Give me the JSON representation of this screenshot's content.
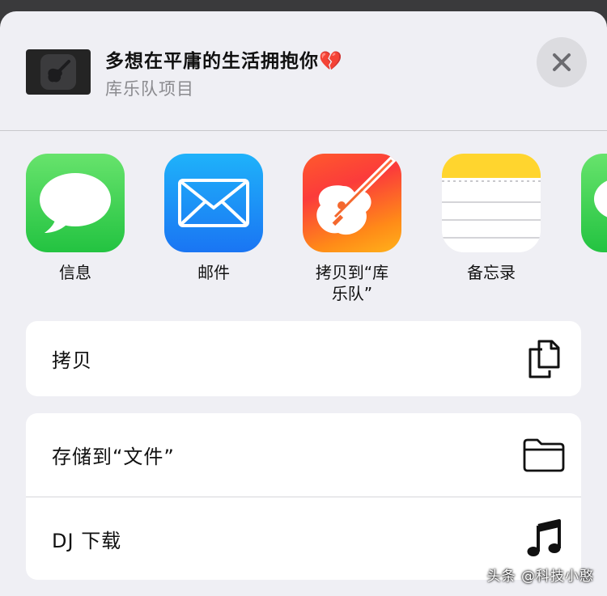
{
  "header": {
    "title": "多想在平庸的生活拥抱你💔",
    "subtitle": "库乐队项目",
    "thumbnail_icon": "guitar-icon",
    "close_icon": "close-icon"
  },
  "apps": [
    {
      "label": "信息",
      "icon": "messages-icon",
      "color": "#34c759"
    },
    {
      "label": "邮件",
      "icon": "mail-icon",
      "color": "#1a8cf5"
    },
    {
      "label": "拷贝到“库\n乐队”",
      "icon": "garageband-icon",
      "color": "#fb4b2f"
    },
    {
      "label": "备忘录",
      "icon": "notes-icon",
      "color": "#ffcc00"
    },
    {
      "label": "",
      "icon": "messages-icon",
      "color": "#34c759"
    }
  ],
  "actions": {
    "copy": {
      "label": "拷贝",
      "icon": "copy-icon"
    },
    "save_to_files": {
      "label": "存储到“文件”",
      "icon": "folder-icon"
    },
    "dj_download": {
      "label": "DJ 下载",
      "icon": "music-note-icon"
    }
  },
  "watermark": "头条 @科技小憨"
}
